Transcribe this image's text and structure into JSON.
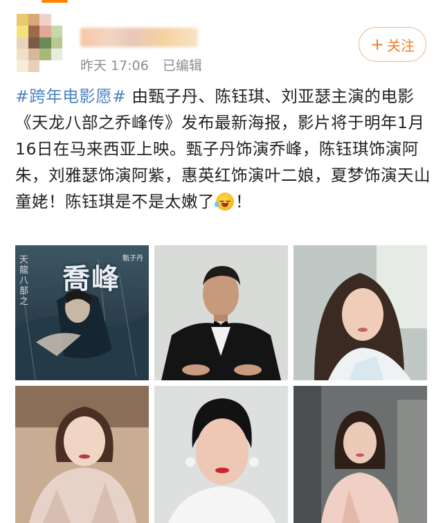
{
  "post": {
    "time": "昨天 17:06",
    "edited": "已编辑",
    "follow_label": "关注",
    "follow_plus": "+",
    "topic": "#跨年电影愿#",
    "body": " 由甄子丹、陈钰琪、刘亚瑟主演的电影《天龙八部之乔峰传》发布最新海报，影片将于明年1月16日在马来西亚上映。甄子丹饰演乔峰，陈钰琪饰演阿朱，刘雅瑟饰演阿紫，惠英红饰演叶二娘，夏梦饰演天山童姥！陈钰琪是不是太嫩了",
    "emoji": "laughing-tears-emoji",
    "tail": "！"
  },
  "poster": {
    "title": "喬峰",
    "side_text": "天龍八部之",
    "credit": "甄子丹"
  },
  "colors": {
    "accent": "#ff8200",
    "topic_blue": "#4a83c4",
    "follow_orange": "#f07c24"
  },
  "images": [
    {
      "name": "movie-poster"
    },
    {
      "name": "man-in-tuxedo-photo"
    },
    {
      "name": "actress-photo-1"
    },
    {
      "name": "actress-photo-2"
    },
    {
      "name": "actress-photo-3"
    },
    {
      "name": "actress-photo-4"
    }
  ]
}
